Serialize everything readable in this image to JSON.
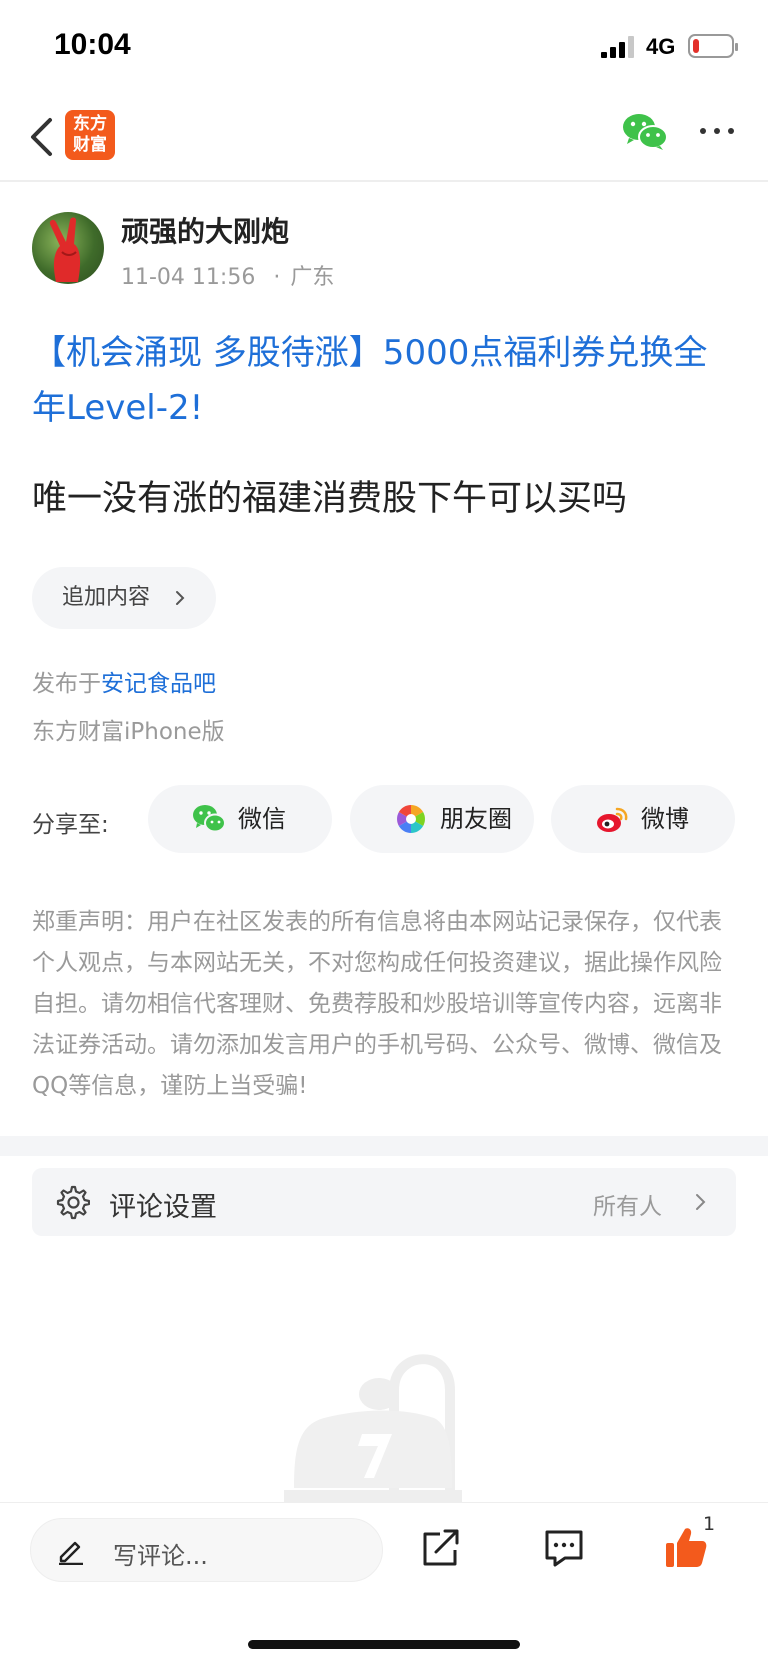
{
  "status_bar": {
    "time": "10:04",
    "network": "4G",
    "battery_level": 0.18,
    "battery_color": "#e3302a"
  },
  "nav": {
    "back_icon": "chevron-left-icon",
    "logo_line1": "东方",
    "logo_line2": "财富",
    "logo_color": "#f35a1c",
    "share_icon": "wechat-icon",
    "more_icon": "more-horizontal-icon"
  },
  "post": {
    "author": "顽强的大刚炮",
    "date": "11-04 11:56",
    "location": "广东",
    "title": "【机会涌现 多股待涨】5000点福利券兑换全年Level-2!",
    "body": "唯一没有涨的福建消费股下午可以买吗",
    "append_label": "追加内容",
    "posted_in_prefix": "发布于",
    "posted_in_link": "安记食品吧",
    "client": "东方财富iPhone版"
  },
  "share": {
    "label": "分享至:",
    "targets": [
      {
        "label": "微信",
        "icon": "wechat-icon"
      },
      {
        "label": "朋友圈",
        "icon": "moments-icon"
      },
      {
        "label": "微博",
        "icon": "weibo-icon"
      }
    ]
  },
  "disclaimer": "郑重声明：用户在社区发表的所有信息将由本网站记录保存，仅代表个人观点，与本网站无关，不对您构成任何投资建议，据此操作风险自担。请勿相信代客理财、免费荐股和炒股培训等宣传内容，远离非法证券活动。请勿添加发言用户的手机号码、公众号、微博、微信及QQ等信息，谨防上当受骗!",
  "comment_settings": {
    "label": "评论设置",
    "value": "所有人",
    "icon": "gear-icon"
  },
  "bottom_bar": {
    "comment_placeholder": "写评论...",
    "like_count": "1",
    "like_color": "#f35a1c",
    "icons": [
      "pen-icon",
      "share-out-icon",
      "comments-icon",
      "thumbs-up-icon"
    ]
  },
  "colors": {
    "link_blue": "#1e6fd8",
    "muted_gray": "#9a9a9a",
    "wechat_green": "#3fc24a",
    "weibo_red": "#e6162d"
  }
}
